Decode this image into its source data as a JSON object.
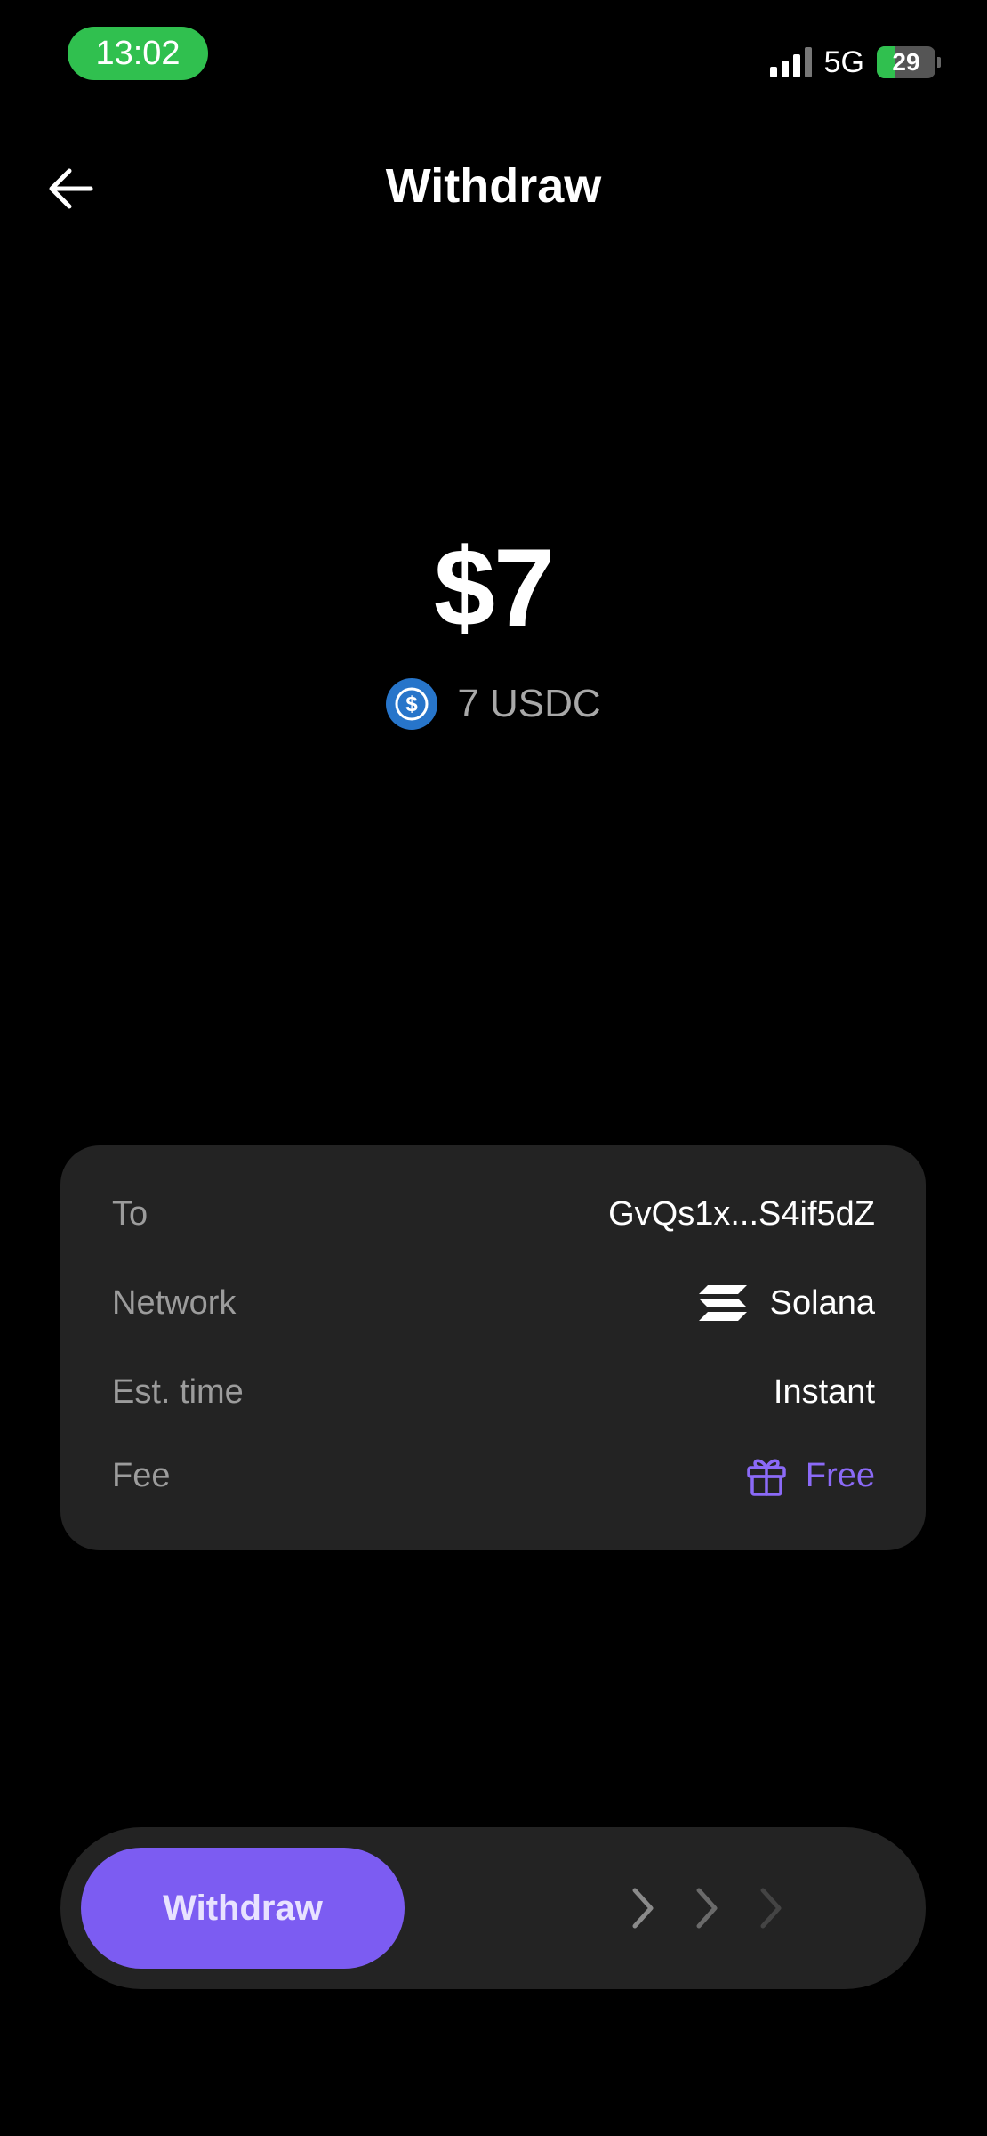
{
  "status_bar": {
    "time": "13:02",
    "network": "5G",
    "battery": "29",
    "battery_level": 0.29,
    "signal_bars_active": 3,
    "accent": "#30c04f"
  },
  "header": {
    "title": "Withdraw",
    "back_icon": "arrow-left-icon"
  },
  "amount": {
    "fiat": "$7",
    "crypto": "7 USDC",
    "crypto_icon": "usdc-coin-icon"
  },
  "details": {
    "to": {
      "label": "To",
      "value": "GvQs1x...S4if5dZ"
    },
    "network": {
      "label": "Network",
      "value": "Solana",
      "icon": "solana-icon"
    },
    "est_time": {
      "label": "Est. time",
      "value": "Instant"
    },
    "fee": {
      "label": "Fee",
      "value": "Free",
      "icon": "gift-icon",
      "color": "#8b6af7"
    }
  },
  "slider": {
    "label": "Withdraw",
    "accent": "#7c5cf2",
    "chevron_icon": "chevron-right-icon"
  }
}
